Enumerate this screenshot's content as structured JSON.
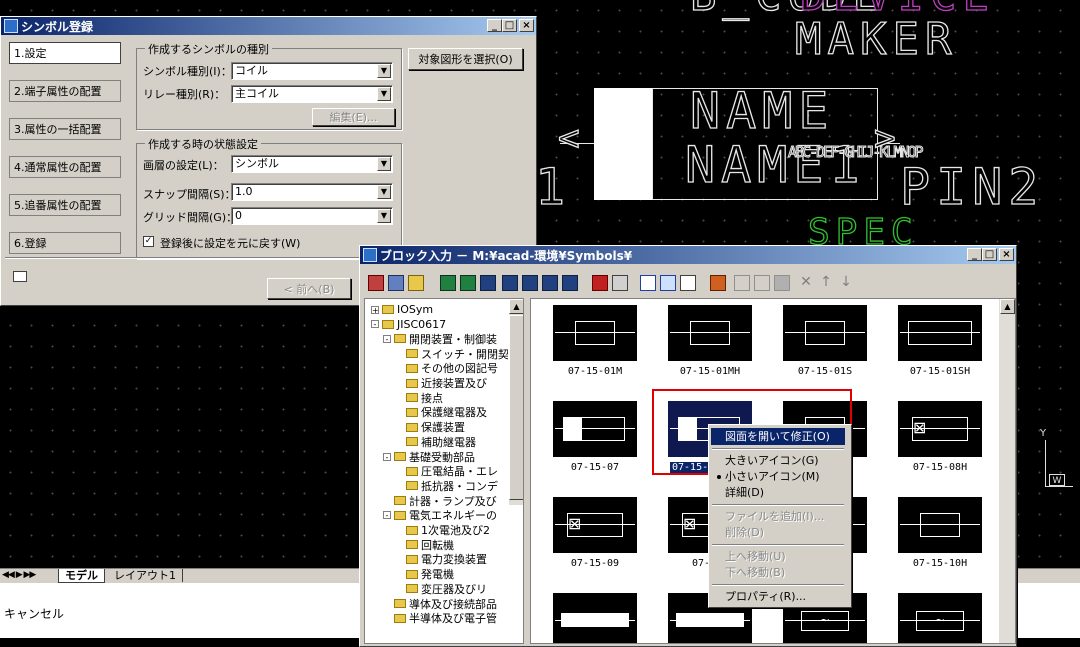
{
  "cad": {
    "texts": {
      "top": "B_CODE",
      "top_pink": "DEVICE",
      "maker": "MAKER",
      "name": "NAME",
      "name1": "NAME1",
      "pin": "PIN2",
      "spec": "SPEC",
      "one": "1",
      "overlap": "ABC-DEF-GHIJ-KLMNOP"
    },
    "tabs": {
      "model": "モデル",
      "layout1": "レイアウト1",
      "nav": "◀◀ ▶ ▶▶"
    },
    "command_line": "キャンセル",
    "ucs": {
      "y": "Y",
      "w": "W"
    }
  },
  "symbol_dialog": {
    "title": "シンボル登録",
    "steps": [
      "1.設定",
      "2.端子属性の配置",
      "3.属性の一括配置",
      "4.通常属性の配置",
      "5.追番属性の配置",
      "6.登録"
    ],
    "selected_step": 0,
    "group1": {
      "legend": "作成するシンボルの種別",
      "symbol_type_label": "シンボル種別(I)：",
      "symbol_type_value": "コイル",
      "relay_type_label": "リレー種別(R)：",
      "relay_type_value": "主コイル",
      "edit_button": "編集(E)..."
    },
    "group2": {
      "legend": "作成する時の状態設定",
      "layer_label": "画層の設定(L)：",
      "layer_value": "シンボル",
      "snap_label": "スナップ間隔(S)：",
      "snap_value": "1.0",
      "grid_label": "グリッド間隔(G)：",
      "grid_value": "0",
      "restore_checkbox": "登録後に設定を元に戻す(W)",
      "restore_checked": true
    },
    "select_button": "対象図形を選択(O)",
    "prev_button": "< 前へ(B)"
  },
  "block_dialog": {
    "title": "ブロック入力 － M:¥acad-環境¥Symbols¥",
    "tree": [
      {
        "label": "IOSym",
        "indent": 0,
        "pm": "+"
      },
      {
        "label": "JISC0617",
        "indent": 0,
        "pm": "-"
      },
      {
        "label": "開閉装置・制御装",
        "indent": 1,
        "pm": "-"
      },
      {
        "label": "スイッチ・開閉契",
        "indent": 2,
        "pm": ""
      },
      {
        "label": "その他の図記号",
        "indent": 2,
        "pm": ""
      },
      {
        "label": "近接装置及び",
        "indent": 2,
        "pm": ""
      },
      {
        "label": "接点",
        "indent": 2,
        "pm": ""
      },
      {
        "label": "保護継電器及",
        "indent": 2,
        "pm": ""
      },
      {
        "label": "保護装置",
        "indent": 2,
        "pm": ""
      },
      {
        "label": "補助継電器",
        "indent": 2,
        "pm": ""
      },
      {
        "label": "基礎受動部品",
        "indent": 1,
        "pm": "-"
      },
      {
        "label": "圧電結晶・エレ",
        "indent": 2,
        "pm": ""
      },
      {
        "label": "抵抗器・コンデ",
        "indent": 2,
        "pm": ""
      },
      {
        "label": "計器・ランプ及び",
        "indent": 1,
        "pm": ""
      },
      {
        "label": "電気エネルギーの",
        "indent": 1,
        "pm": "-"
      },
      {
        "label": "1次電池及び2",
        "indent": 2,
        "pm": ""
      },
      {
        "label": "回転機",
        "indent": 2,
        "pm": ""
      },
      {
        "label": "電力変換装置",
        "indent": 2,
        "pm": ""
      },
      {
        "label": "発電機",
        "indent": 2,
        "pm": ""
      },
      {
        "label": "変圧器及びリ",
        "indent": 2,
        "pm": ""
      },
      {
        "label": "導体及び接続部品",
        "indent": 1,
        "pm": ""
      },
      {
        "label": "半導体及び電子管",
        "indent": 1,
        "pm": ""
      }
    ],
    "tiles": [
      {
        "caption": "07-15-01M",
        "kind": "box-small"
      },
      {
        "caption": "07-15-01MH",
        "kind": "box-small"
      },
      {
        "caption": "07-15-01S",
        "kind": "box-small"
      },
      {
        "caption": "07-15-01SH",
        "kind": "box-wide"
      },
      {
        "caption": "07-15-07",
        "kind": "box-filled"
      },
      {
        "caption": "07-15-",
        "kind": "box-filled-sel"
      },
      {
        "caption": "",
        "kind": "box-small"
      },
      {
        "caption": "07-15-08H",
        "kind": "box-cross"
      },
      {
        "caption": "07-15-09",
        "kind": "box-cross"
      },
      {
        "caption": "07-15-",
        "kind": "box-cross"
      },
      {
        "caption": "",
        "kind": "box-small"
      },
      {
        "caption": "07-15-10H",
        "kind": "box-small"
      },
      {
        "caption": "",
        "kind": "bars"
      },
      {
        "caption": "",
        "kind": "bars"
      },
      {
        "caption": "",
        "kind": "wave"
      },
      {
        "caption": "",
        "kind": "wave"
      }
    ],
    "context_menu": [
      {
        "label": "図面を開いて修正(O)",
        "state": "highlight"
      },
      {
        "label": "大きいアイコン(G)",
        "state": "normal"
      },
      {
        "label": "小さいアイコン(M)",
        "state": "bullet"
      },
      {
        "label": "詳細(D)",
        "state": "normal"
      },
      {
        "label": "ファイルを追加(I)...",
        "state": "disabled"
      },
      {
        "label": "削除(D)",
        "state": "disabled"
      },
      {
        "label": "上へ移動(U)",
        "state": "disabled"
      },
      {
        "label": "下へ移動(B)",
        "state": "disabled"
      },
      {
        "label": "プロパティ(R)...",
        "state": "normal"
      }
    ]
  },
  "colors": {
    "highlight": "#0a246a",
    "annotation_red": "#e00000",
    "device_pink": "#c040c0",
    "spec_green": "#30c030"
  }
}
